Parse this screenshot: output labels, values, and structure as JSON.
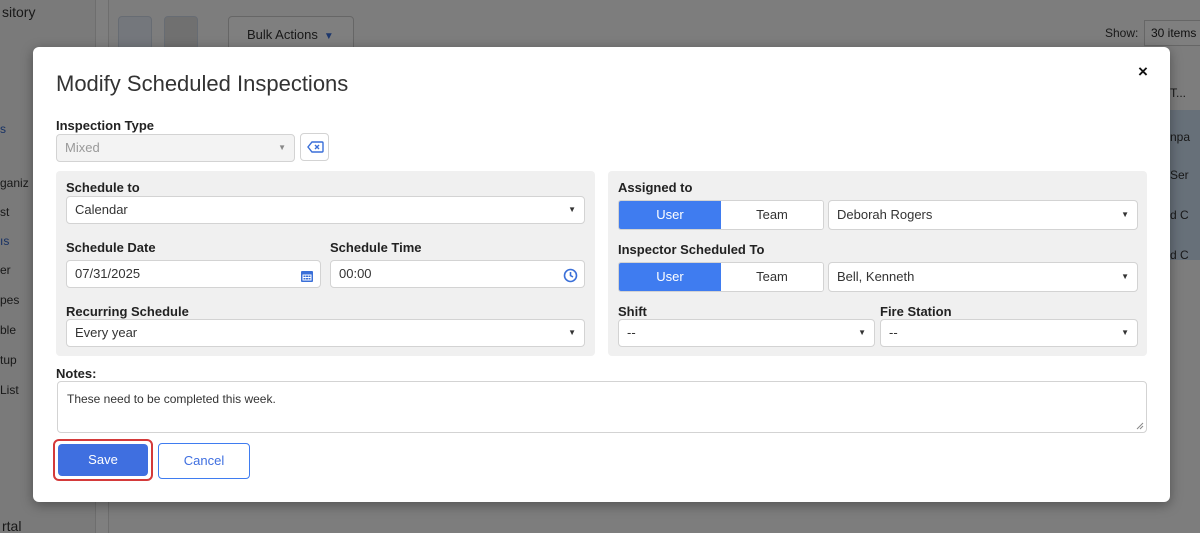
{
  "background": {
    "sidebar_title": "sitory",
    "sidebar_items": [
      {
        "label": "s",
        "active": true
      },
      {
        "label": "ganiz",
        "active": false
      },
      {
        "label": "st",
        "active": false
      },
      {
        "label": "ıs",
        "active": true
      },
      {
        "label": "er",
        "active": false
      },
      {
        "label": "pes",
        "active": false
      },
      {
        "label": "ble",
        "active": false
      },
      {
        "label": "tup",
        "active": false
      },
      {
        "label": "List",
        "active": false
      }
    ],
    "sidebar_footer": "rtal",
    "bulk_actions_label": "Bulk Actions",
    "show_label": "Show:",
    "show_value": "30 items",
    "column_header": "T...",
    "row_fragments": [
      "npa",
      "Ser",
      "d C",
      "d C"
    ]
  },
  "modal": {
    "title": "Modify Scheduled Inspections",
    "inspection_type": {
      "label": "Inspection Type",
      "value": "Mixed"
    },
    "schedule_to": {
      "label": "Schedule to",
      "value": "Calendar"
    },
    "schedule_date": {
      "label": "Schedule Date",
      "value": "07/31/2025"
    },
    "schedule_time": {
      "label": "Schedule Time",
      "value": "00:00"
    },
    "recurring_schedule": {
      "label": "Recurring Schedule",
      "value": "Every year"
    },
    "assigned_to": {
      "label": "Assigned to",
      "option_user": "User",
      "option_team": "Team",
      "selected": "User",
      "value": "Deborah Rogers"
    },
    "inspector_scheduled_to": {
      "label": "Inspector Scheduled To",
      "option_user": "User",
      "option_team": "Team",
      "selected": "User",
      "value": "Bell, Kenneth"
    },
    "shift": {
      "label": "Shift",
      "value": "--"
    },
    "fire_station": {
      "label": "Fire Station",
      "value": "--"
    },
    "notes": {
      "label": "Notes:",
      "value": "These need to be completed this week."
    },
    "save_label": "Save",
    "cancel_label": "Cancel",
    "close_label": "×"
  },
  "colors": {
    "primary": "#3f7cf0",
    "save_button": "#3f6fe0",
    "highlight_border": "#d43a3a"
  }
}
